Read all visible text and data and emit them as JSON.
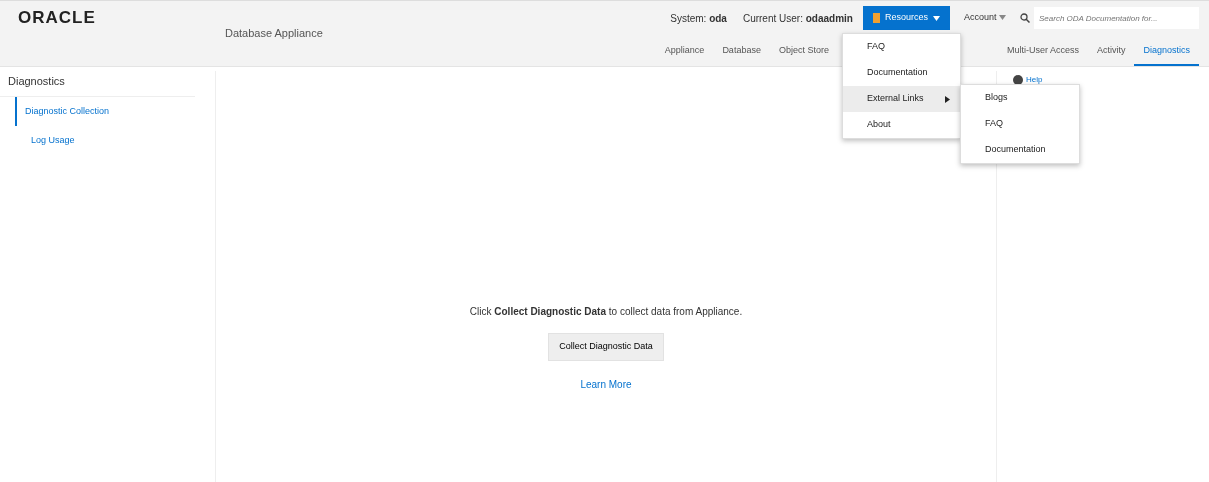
{
  "header": {
    "logo": "ORACLE",
    "product": "Database Appliance",
    "system_label": "System:",
    "system_value": "oda",
    "user_label": "Current User:",
    "user_value": "odaadmin",
    "resources_menu": {
      "label": "Resources",
      "expanded": true
    },
    "account_menu": {
      "label": "Account",
      "expanded": false
    },
    "search": {
      "placeholder": "Search ODA Documentation for..."
    }
  },
  "tabs": [
    {
      "label": "Appliance",
      "selected": false
    },
    {
      "label": "Database",
      "selected": false
    },
    {
      "label": "Object Store",
      "selected": false
    },
    {
      "label": "Multi-User Access",
      "selected": false
    },
    {
      "label": "Activity",
      "selected": false
    },
    {
      "label": "Diagnostics",
      "selected": true
    }
  ],
  "resources_dropdown": [
    {
      "label": "FAQ",
      "highlighted": false,
      "has_submenu": false
    },
    {
      "label": "Documentation",
      "highlighted": false,
      "has_submenu": false
    },
    {
      "label": "External Links",
      "highlighted": true,
      "has_submenu": true
    },
    {
      "label": "About",
      "highlighted": false,
      "has_submenu": false
    }
  ],
  "external_links_submenu": [
    "Blogs",
    "FAQ",
    "Documentation"
  ],
  "sidebar": {
    "title": "Diagnostics",
    "items": [
      {
        "label": "Diagnostic Collection",
        "selected": true
      },
      {
        "label": "Log Usage",
        "selected": false
      }
    ]
  },
  "main": {
    "message": "Click **Collect Diagnostic Data** to collect data from Appliance.",
    "button": "Collect Diagnostic Data",
    "link": "Learn More"
  },
  "help": "Help"
}
